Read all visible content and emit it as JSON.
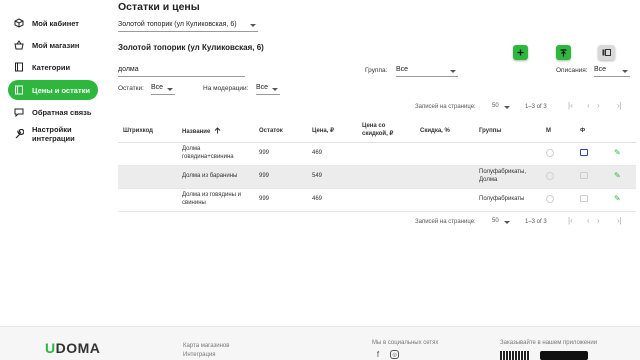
{
  "sidebar": {
    "items": [
      {
        "label": "Мой кабинет",
        "icon": "cube-icon"
      },
      {
        "label": "Мой магазин",
        "icon": "basket-icon"
      },
      {
        "label": "Категории",
        "icon": "book-icon"
      },
      {
        "label": "Цены и остатки",
        "icon": "book-icon",
        "active": true
      },
      {
        "label": "Обратная связь",
        "icon": "chat-icon"
      },
      {
        "label": "Настройки интеграции",
        "icon": "wrench-icon"
      }
    ]
  },
  "header": {
    "title": "Остатки и цены",
    "store_select": "Золотой топорик (ул Куликовская, 6)",
    "store_name": "Золотой топорик (ул Куликовская, 6)"
  },
  "filters": {
    "search_value": "долма",
    "group_label": "Группа:",
    "group_value": "Все",
    "descriptions_label": "Описания:",
    "descriptions_value": "Все",
    "stock_label": "Остатки:",
    "stock_value": "Все",
    "moderation_label": "На модерации:",
    "moderation_value": "Все"
  },
  "pagination": {
    "per_page_label": "Записей на странице:",
    "per_page_value": "50",
    "range": "1–3 of 3"
  },
  "table": {
    "columns": [
      "Штрихкод",
      "Название",
      "Остаток",
      "Цена, ₽",
      "Цена со скидкой, ₽",
      "Скидка, %",
      "Группы",
      "М",
      "Ф"
    ],
    "rows": [
      {
        "barcode": "",
        "name": "Долма говядина+свинина",
        "stock": "999",
        "price": "469",
        "discount_price": "",
        "discount": "",
        "groups": "",
        "photo": true
      },
      {
        "barcode": "",
        "name": "Долма из баранины",
        "stock": "999",
        "price": "549",
        "discount_price": "",
        "discount": "",
        "groups": "Полуфабрикаты, Долма",
        "photo": false
      },
      {
        "barcode": "",
        "name": "Долма из говядины и свинины",
        "stock": "999",
        "price": "469",
        "discount_price": "",
        "discount": "",
        "groups": "Полуфабрикаты",
        "photo": false
      }
    ]
  },
  "footer": {
    "logo": "DOMA",
    "logo_u": "U",
    "links": [
      "Карта магазинов",
      "Интеграция"
    ],
    "social_label": "Мы в социальных сетях",
    "app_label": "Заказывайте в нашем приложении"
  },
  "colors": {
    "accent": "#2db83d"
  }
}
